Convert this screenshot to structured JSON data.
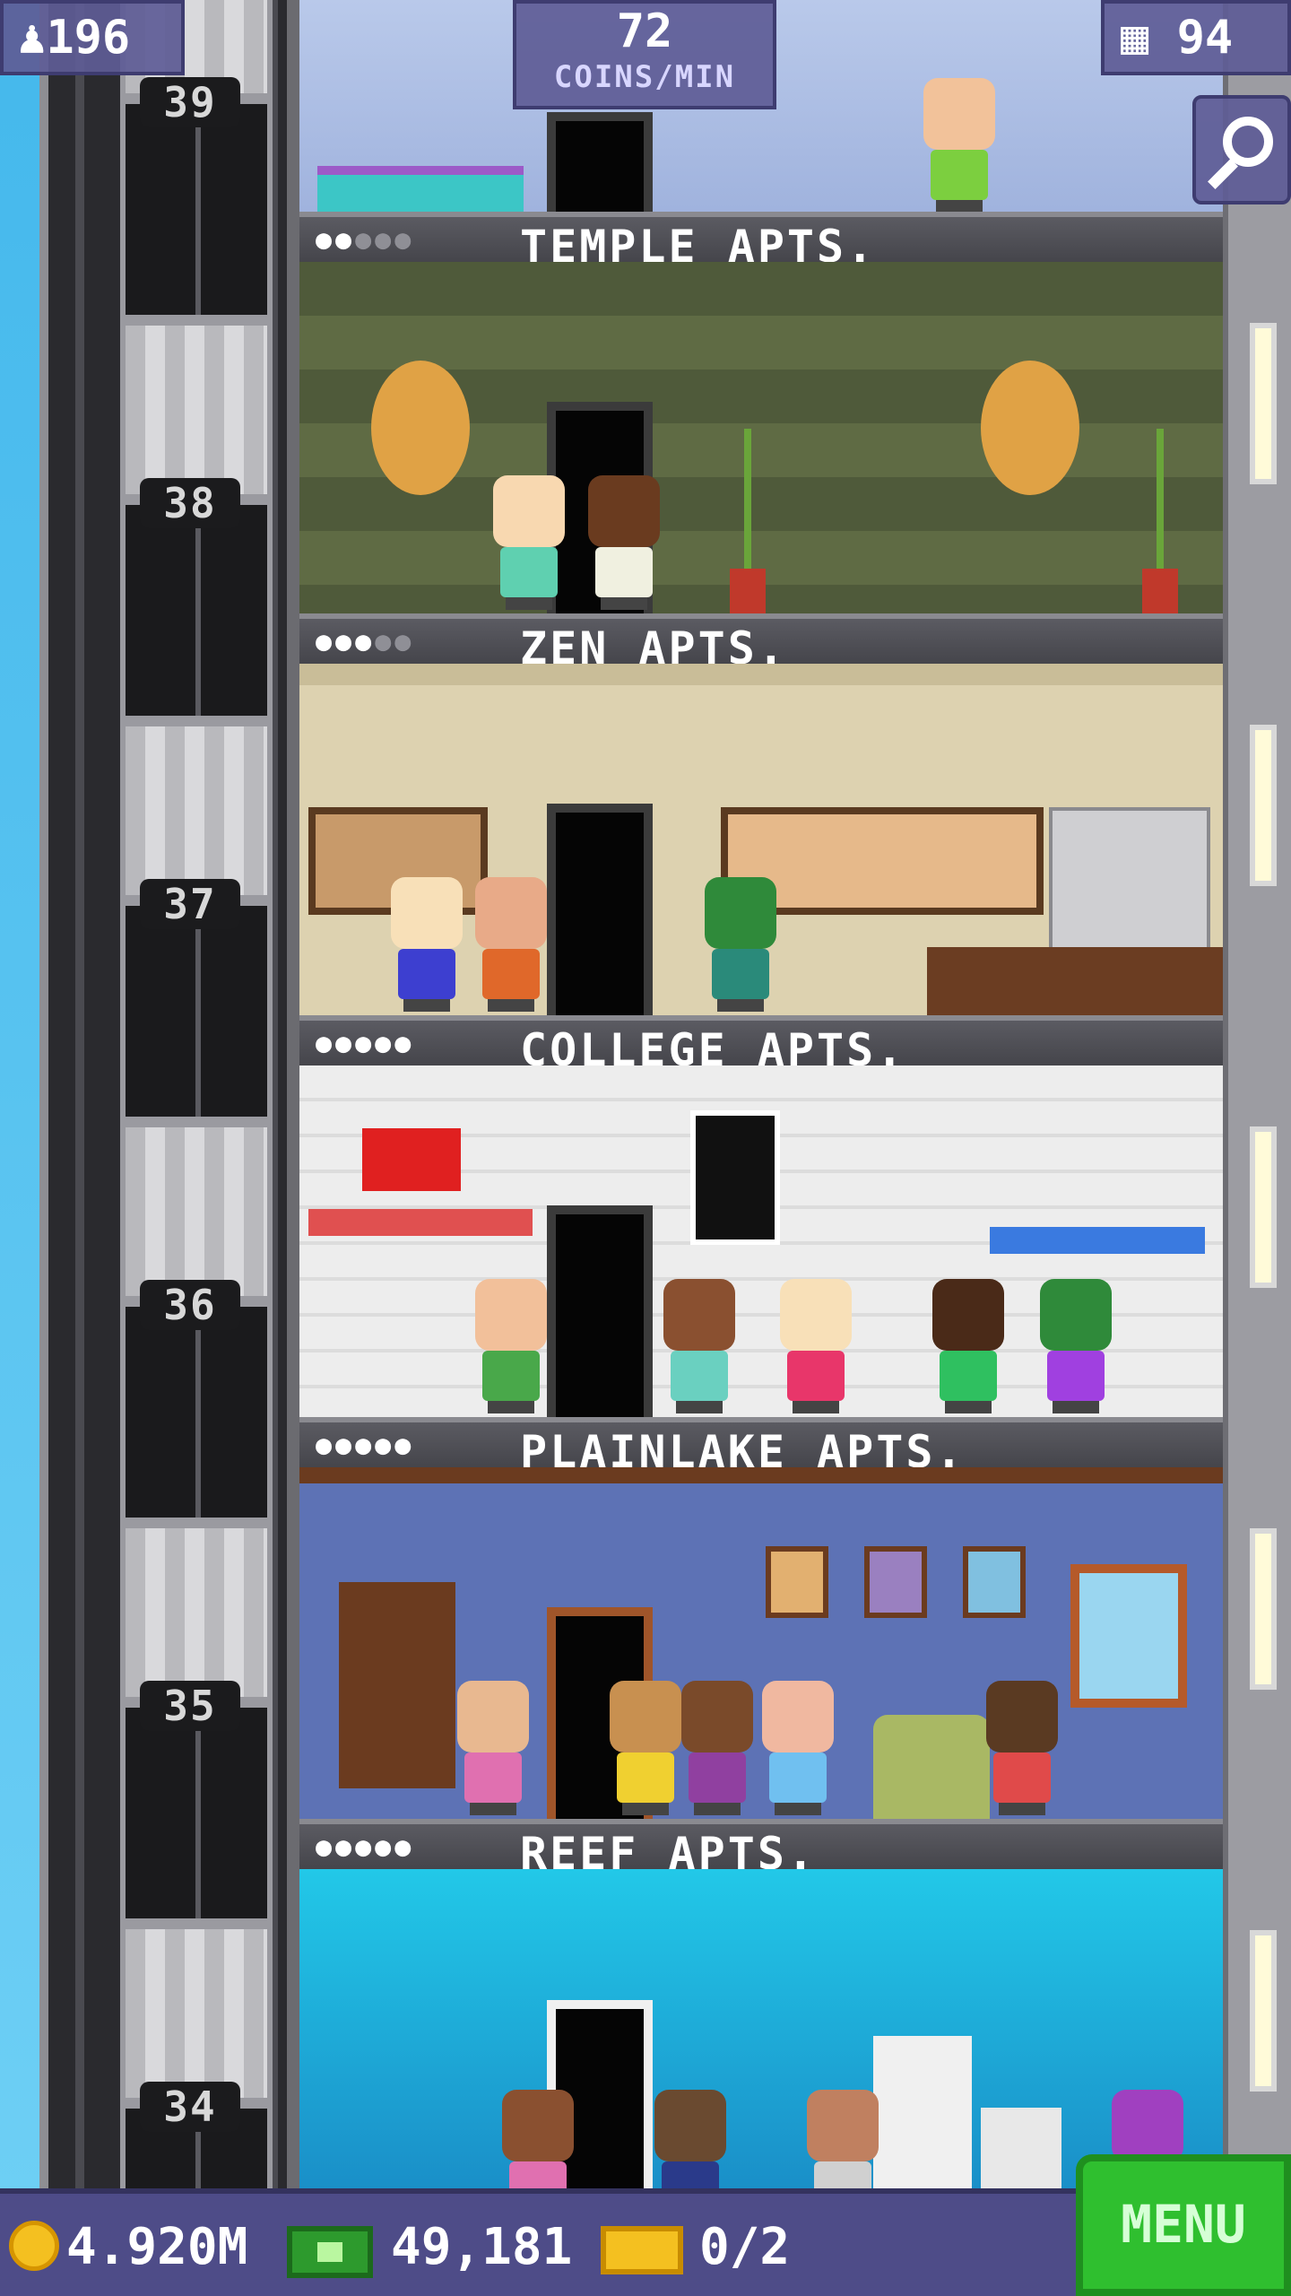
{
  "hud": {
    "population": "196",
    "coins_per_min_value": "72",
    "coins_per_min_label": "COINS/MIN",
    "floors": "94"
  },
  "elevator": {
    "floor_numbers": [
      "39",
      "38",
      "37",
      "36",
      "35",
      "34"
    ]
  },
  "floors": [
    {
      "name": "TEMPLE APTS.",
      "stars_filled": 2,
      "stars_total": 5
    },
    {
      "name": "ZEN APTS.",
      "stars_filled": 3,
      "stars_total": 5
    },
    {
      "name": "COLLEGE APTS.",
      "stars_filled": 5,
      "stars_total": 5
    },
    {
      "name": "PLAINLAKE APTS.",
      "stars_filled": 5,
      "stars_total": 5
    },
    {
      "name": "REEF APTS.",
      "stars_filled": 5,
      "stars_total": 5
    }
  ],
  "bottom_bar": {
    "coins": "4.920M",
    "bux": "49,181",
    "tickets": "0/2",
    "menu_label": "MENU"
  },
  "icons": [
    "population-icon",
    "floors-icon",
    "search-icon",
    "coin-icon",
    "bux-icon",
    "ticket-icon"
  ],
  "colors": {
    "hud_bg": "#5e5c96",
    "menu_green": "#2fbf2f",
    "coin_gold": "#f4c020",
    "sky": "#5ec4f0"
  }
}
